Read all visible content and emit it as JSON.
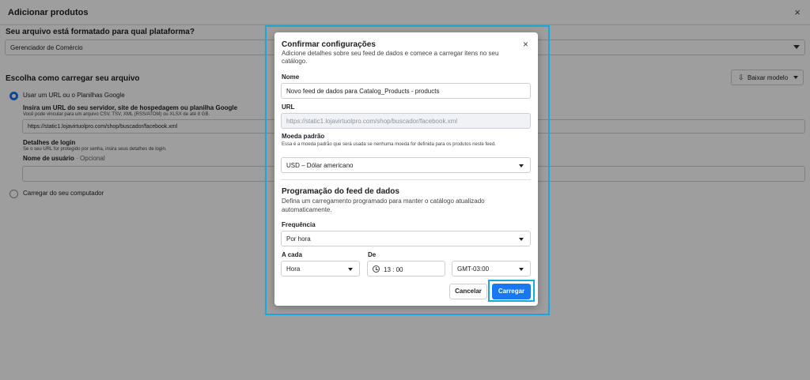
{
  "background": {
    "title": "Adicionar produtos",
    "close_icon": "×",
    "platform_question": "Seu arquivo está formatado para qual plataforma?",
    "platform_value": "Gerenciador de Comércio",
    "upload_question": "Escolha como carregar seu arquivo",
    "download_button": "Baixar modelo",
    "option_url_label": "Usar um URL ou o Planilhas Google",
    "url_title": "Insira um URL do seu servidor, site de hospedagem ou planilha Google",
    "url_help": "Você pode vincular para um arquivo CSV, TSV, XML (RSS/ATOM) ou XLSX de até 8 GB.",
    "url_value": "https://static1.lojavirtuolpro.com/shop/buscador/facebook.xml",
    "login_title": "Detalhes de login",
    "login_help": "Se o seu URL for protegido por senha, insira seus detalhes de login.",
    "username_label": "Nome de usuário",
    "username_optional": "· Opcional",
    "option_computer_label": "Carregar do seu computador"
  },
  "modal": {
    "title": "Confirmar configurações",
    "subtitle": "Adicione detalhes sobre seu feed de dados e comece a carregar itens no seu catálogo.",
    "close_icon": "×",
    "name_label": "Nome",
    "name_value": "Novo feed de dados para Catalog_Products - products",
    "url_label": "URL",
    "url_value": "https://static1.lojavirtuolpro.com/shop/buscador/facebook.xml",
    "currency_label": "Moeda padrão",
    "currency_help": "Essa é a moeda padrão que será usada se nenhuma moeda for definida para os produtos neste feed.",
    "currency_value": "USD – Dólar americano",
    "schedule_title": "Programação do feed de dados",
    "schedule_subtitle": "Defina um carregamento programado para manter o catálogo atualizado automaticamente.",
    "frequency_label": "Frequência",
    "frequency_value": "Por hora",
    "every_label": "A cada",
    "every_value": "Hora",
    "from_label": "De",
    "time_value": "13 : 00",
    "timezone_value": "GMT-03:00",
    "cancel_button": "Cancelar",
    "submit_button": "Carregar"
  },
  "colors": {
    "accent": "#1877f2",
    "highlight": "#1aa7d9"
  }
}
